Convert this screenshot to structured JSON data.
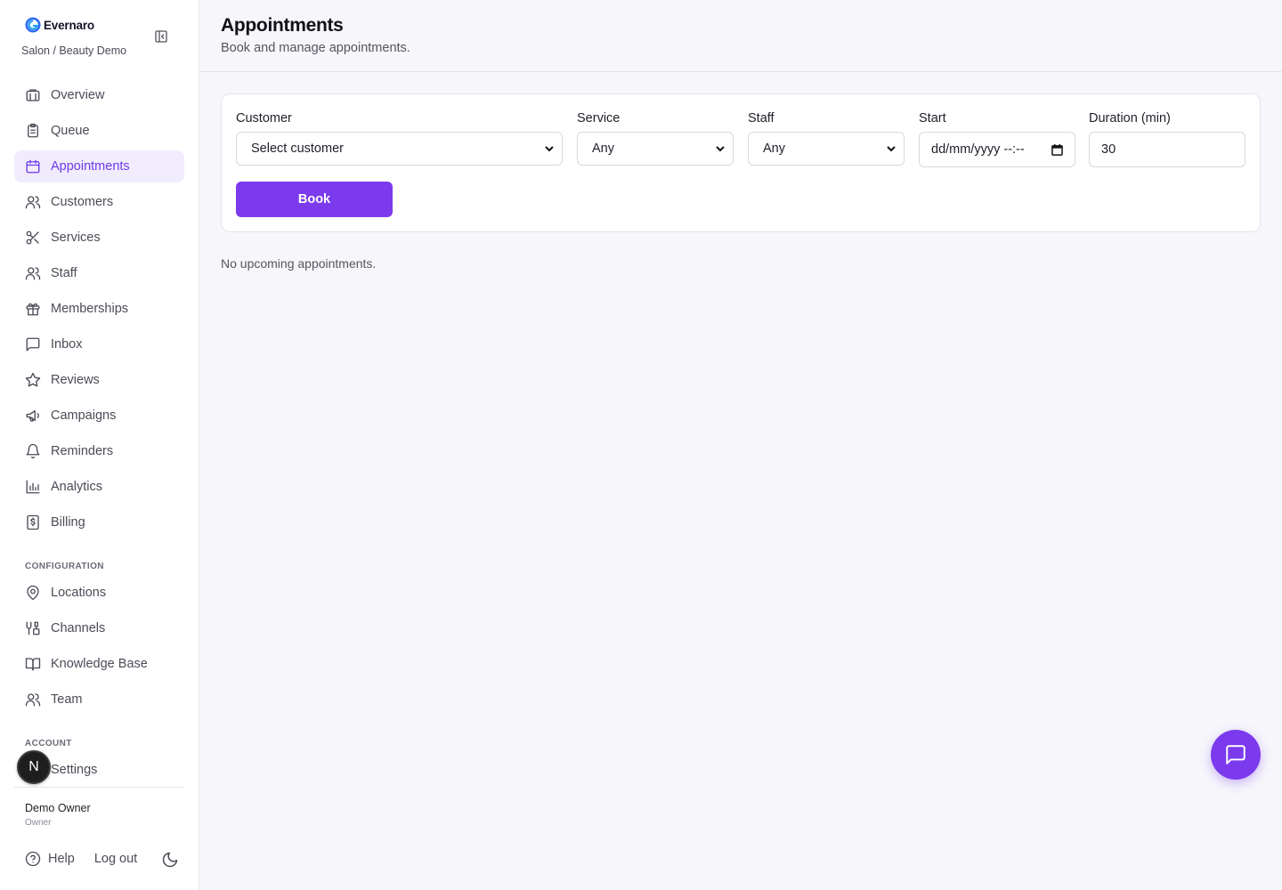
{
  "brand": {
    "name": "Evernaro",
    "workspace": "Salon / Beauty Demo"
  },
  "sidebar": {
    "items": [
      {
        "label": "Overview",
        "icon": "building-icon"
      },
      {
        "label": "Queue",
        "icon": "clipboard-icon"
      },
      {
        "label": "Appointments",
        "icon": "calendar-icon",
        "active": true
      },
      {
        "label": "Customers",
        "icon": "users-icon"
      },
      {
        "label": "Services",
        "icon": "scissors-icon"
      },
      {
        "label": "Staff",
        "icon": "users-icon"
      },
      {
        "label": "Memberships",
        "icon": "gift-icon"
      },
      {
        "label": "Inbox",
        "icon": "message-square-icon"
      },
      {
        "label": "Reviews",
        "icon": "star-icon"
      },
      {
        "label": "Campaigns",
        "icon": "megaphone-icon"
      },
      {
        "label": "Reminders",
        "icon": "bell-icon"
      },
      {
        "label": "Analytics",
        "icon": "bar-chart-icon"
      },
      {
        "label": "Billing",
        "icon": "receipt-icon"
      }
    ],
    "config_label": "Configuration",
    "config_items": [
      {
        "label": "Locations",
        "icon": "map-pin-icon"
      },
      {
        "label": "Channels",
        "icon": "channels-icon"
      },
      {
        "label": "Knowledge Base",
        "icon": "book-open-icon"
      },
      {
        "label": "Team",
        "icon": "users-icon"
      }
    ],
    "account_label": "Account",
    "account_items": [
      {
        "label": "Settings",
        "icon": "settings-icon"
      }
    ],
    "user": {
      "name": "Demo Owner",
      "role": "Owner"
    },
    "help_label": "Help",
    "logout_label": "Log out",
    "avatar_letter": "N"
  },
  "header": {
    "title": "Appointments",
    "subtitle": "Book and manage appointments."
  },
  "form": {
    "customer": {
      "label": "Customer",
      "value": "Select customer"
    },
    "service": {
      "label": "Service",
      "value": "Any"
    },
    "staff": {
      "label": "Staff",
      "value": "Any"
    },
    "start": {
      "label": "Start",
      "value": "dd/mm/yyyy --:--"
    },
    "duration": {
      "label": "Duration (min)",
      "value": "30"
    },
    "book_label": "Book"
  },
  "empty_message": "No upcoming appointments.",
  "colors": {
    "accent": "#7c3aed",
    "active_bg": "#f1ecfd",
    "page_bg": "#f6f6fb"
  }
}
